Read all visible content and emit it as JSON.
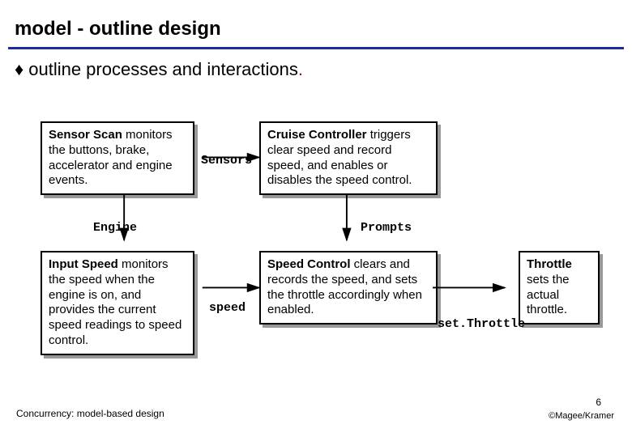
{
  "slide_title": "model - outline design",
  "bullet_text": "outline processes and interactions",
  "boxes": {
    "sensor_scan": {
      "strong": "Sensor Scan",
      "rest": " monitors the buttons, brake, accelerator and engine events."
    },
    "cruise_controller": {
      "strong": "Cruise Controller",
      "rest": " triggers clear speed and record speed, and enables or disables the speed control."
    },
    "input_speed": {
      "strong": "Input Speed",
      "rest": " monitors the speed when the engine is on, and provides the current speed readings to speed control."
    },
    "speed_control": {
      "strong": "Speed Control",
      "rest": " clears and records the speed, and sets the throttle accordingly when enabled."
    },
    "throttle": {
      "strong": "Throttle",
      "rest": " sets the actual throttle."
    }
  },
  "labels": {
    "sensors": "Sensors",
    "engine": "Engine",
    "prompts": "Prompts",
    "speed": "speed",
    "set_throttle": "set.Throttle"
  },
  "footer": {
    "left": "Concurrency: model-based design",
    "pagenum": "6",
    "right": "©Magee/Kramer"
  }
}
